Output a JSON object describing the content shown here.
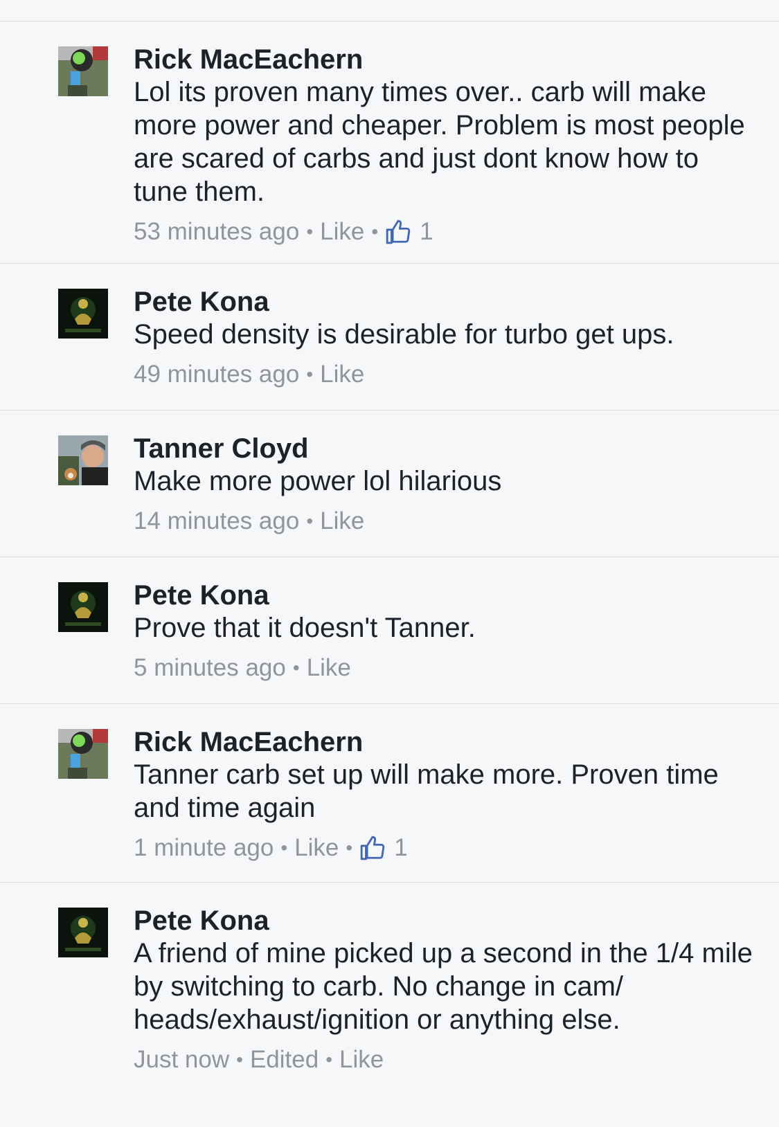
{
  "comments": [
    {
      "author": "Rick MacEachern",
      "text": "Lol its proven many times over.. carb will make more power and cheaper. Problem is  most people are scared of carbs and just dont know how to tune them.",
      "time": "53 minutes ago",
      "like_label": "Like",
      "likes": "1"
    },
    {
      "author": "Pete Kona",
      "text": "Speed density is desirable for turbo get ups.",
      "time": "49 minutes ago",
      "like_label": "Like"
    },
    {
      "author": "Tanner Cloyd",
      "text": "Make more power lol hilarious",
      "time": "14 minutes ago",
      "like_label": "Like"
    },
    {
      "author": "Pete Kona",
      "text": "Prove that it doesn't Tanner.",
      "time": "5 minutes ago",
      "like_label": "Like"
    },
    {
      "author": "Rick MacEachern",
      "text": "Tanner carb set up will make more. Proven time and time again",
      "time": "1 minute ago",
      "like_label": "Like",
      "likes": "1"
    },
    {
      "author": "Pete Kona",
      "text": "A friend of mine picked up a second in the 1/4 mile by switching to carb. No change in cam/ heads/exhaust/ignition or anything else.",
      "time": "Just now",
      "edited": "Edited",
      "like_label": "Like"
    }
  ],
  "colors": {
    "background": "#f6f7f9",
    "divider": "#dddfe2",
    "meta_text": "#90949c",
    "like_icon": "#4267b2"
  }
}
